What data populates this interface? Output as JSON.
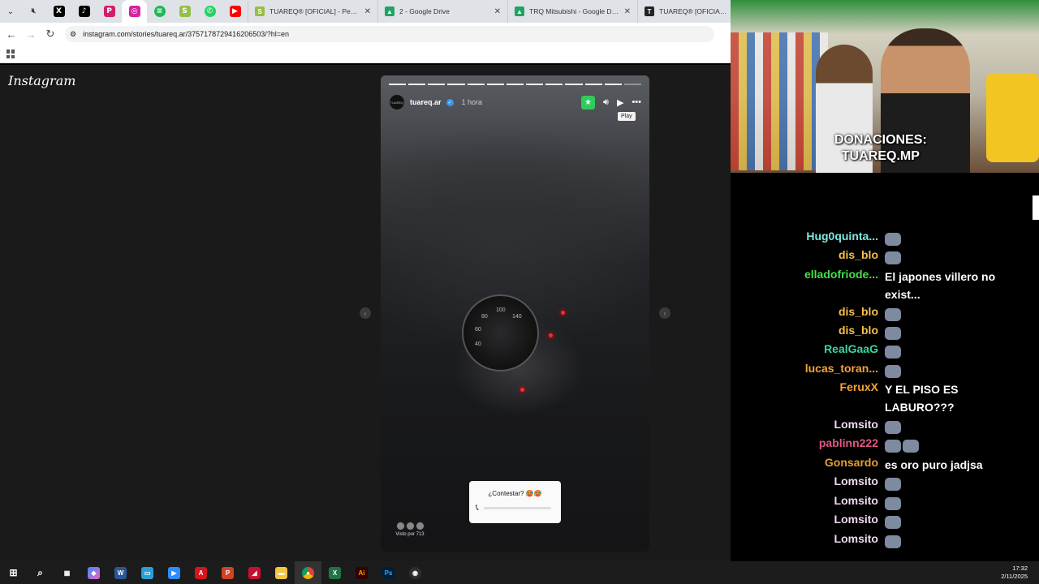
{
  "browser": {
    "tabs": [
      {
        "title": "TUAREQ® [OFICIAL] - Pedidos",
        "favicon": "shopify-icon",
        "color": "#95bf47"
      },
      {
        "title": "2 - Google Drive",
        "favicon": "drive-icon",
        "color": "#1fa463"
      },
      {
        "title": "TRQ Mitsubishi - Google Drive",
        "favicon": "drive-icon",
        "color": "#1fa463"
      },
      {
        "title": "TUAREQ® [OFICIAL] – VER T",
        "favicon": "tuareq-icon",
        "color": "#222222"
      }
    ],
    "url": "instagram.com/stories/tuareq.ar/3757178729416206503/?hl=en"
  },
  "instagram": {
    "logo": "Instagram",
    "story": {
      "username": "tuareq.ar",
      "time": "1 hora",
      "tooltip": "Play",
      "reply_prompt": "¿Contestar? 🥵🥵",
      "seen_by": "Visto por 713",
      "avatar_text": "TUAREQ",
      "progress_total": 13,
      "progress_current": 12
    }
  },
  "stream": {
    "donation_text": "DONACIONES:\nTUAREQ.MP",
    "donation_line1": "DONACIONES:",
    "donation_line2": "TUAREQ.MP",
    "chat": [
      {
        "user": "Hug0quinta...",
        "color": "#7ee8e0",
        "msg": "",
        "emotes": 1
      },
      {
        "user": "dis_blo",
        "color": "#f5c04a",
        "msg": "",
        "emotes": 1
      },
      {
        "user": "elladofriode...",
        "color": "#46e04a",
        "msg": "El japones villero no exist...",
        "emotes": 0
      },
      {
        "user": "dis_blo",
        "color": "#f5c04a",
        "msg": "",
        "emotes": 1
      },
      {
        "user": "dis_blo",
        "color": "#f5c04a",
        "msg": "",
        "emotes": 1
      },
      {
        "user": "RealGaaG",
        "color": "#3ad6a0",
        "msg": "",
        "emotes": 1
      },
      {
        "user": "lucas_toran...",
        "color": "#f5a33a",
        "msg": "",
        "emotes": 1
      },
      {
        "user": "FeruxX",
        "color": "#f5a33a",
        "msg": "Y EL PISO ES LABURO???",
        "emotes": 0
      },
      {
        "user": "Lomsito",
        "color": "#f0d8f0",
        "msg": "",
        "emotes": 1
      },
      {
        "user": "pablinn222",
        "color": "#e0578a",
        "msg": "",
        "emotes": 2
      },
      {
        "user": "Gonsardo",
        "color": "#e6a02a",
        "msg": "es oro puro jadjsa",
        "emotes": 0
      },
      {
        "user": "Lomsito",
        "color": "#f0d8f0",
        "msg": "",
        "emotes": 1
      },
      {
        "user": "Lomsito",
        "color": "#f0d8f0",
        "msg": "",
        "emotes": 1
      },
      {
        "user": "Lomsito",
        "color": "#f0d8f0",
        "msg": "",
        "emotes": 1
      },
      {
        "user": "Lomsito",
        "color": "#f0d8f0",
        "msg": "",
        "emotes": 1
      }
    ]
  },
  "taskbar": {
    "time": "17:32",
    "date": "2/11/2025"
  }
}
